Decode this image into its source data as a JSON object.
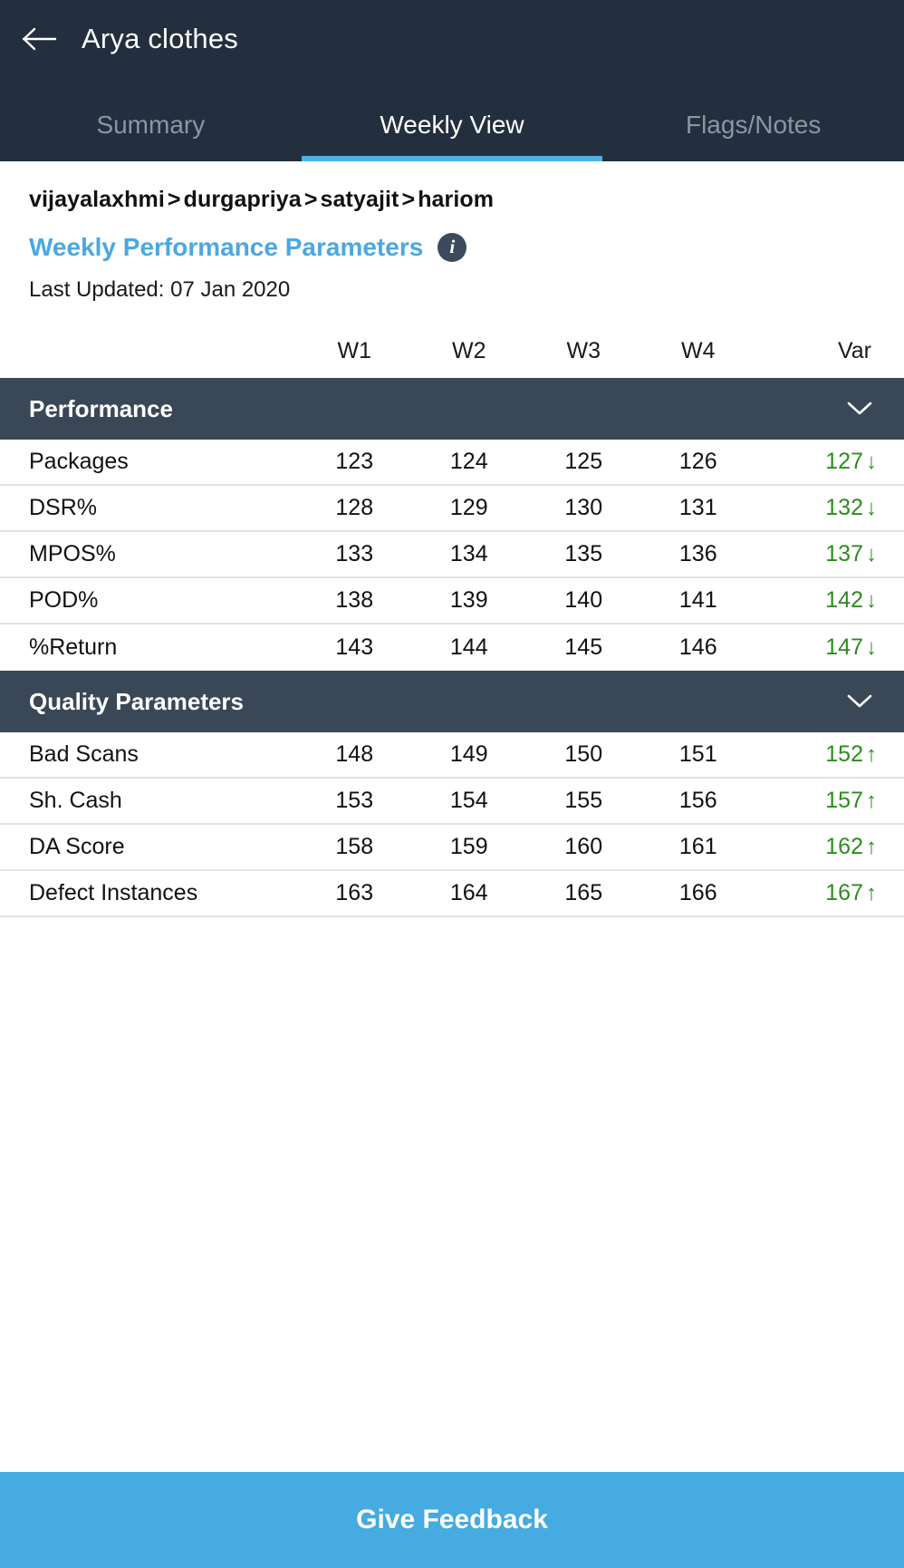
{
  "appbar": {
    "back_icon": "arrow-left-icon",
    "title": "Arya clothes",
    "tabs": [
      {
        "label": "Summary",
        "active": false
      },
      {
        "label": "Weekly View",
        "active": true
      },
      {
        "label": "Flags/Notes",
        "active": false
      }
    ],
    "background_color": "#232F3E",
    "active_tab_underline_color": "#4CB0E4"
  },
  "meta": {
    "breadcrumb": [
      "vijayalaxhmi",
      "durgapriya",
      "satyajit",
      "hariom"
    ],
    "breadcrumb_separator": ">",
    "section_title": "Weekly Performance Parameters",
    "section_title_color": "#4BA8E0",
    "info_icon": "info-icon",
    "info_icon_glyph": "i",
    "last_updated": "Last Updated: 07 Jan 2020"
  },
  "table": {
    "columns": [
      "W1",
      "W2",
      "W3",
      "W4",
      "Var"
    ],
    "groups": [
      {
        "title": "Performance",
        "chevron_icon": "chevron-down-icon",
        "rows": [
          {
            "label": "Packages",
            "values": [
              "123",
              "124",
              "125",
              "126"
            ],
            "var": "127",
            "trend": "down",
            "var_color": "#2E8B20"
          },
          {
            "label": "DSR%",
            "values": [
              "128",
              "129",
              "130",
              "131"
            ],
            "var": "132",
            "trend": "down",
            "var_color": "#2E8B20"
          },
          {
            "label": "MPOS%",
            "values": [
              "133",
              "134",
              "135",
              "136"
            ],
            "var": "137",
            "trend": "down",
            "var_color": "#2E8B20"
          },
          {
            "label": "POD%",
            "values": [
              "138",
              "139",
              "140",
              "141"
            ],
            "var": "142",
            "trend": "down",
            "var_color": "#2E8B20"
          },
          {
            "label": "%Return",
            "values": [
              "143",
              "144",
              "145",
              "146"
            ],
            "var": "147",
            "trend": "down",
            "var_color": "#2E8B20"
          }
        ]
      },
      {
        "title": "Quality Parameters",
        "chevron_icon": "chevron-down-icon",
        "rows": [
          {
            "label": "Bad Scans",
            "values": [
              "148",
              "149",
              "150",
              "151"
            ],
            "var": "152",
            "trend": "up",
            "var_color": "#2E8B20"
          },
          {
            "label": "Sh. Cash",
            "values": [
              "153",
              "154",
              "155",
              "156"
            ],
            "var": "157",
            "trend": "up",
            "var_color": "#2E8B20"
          },
          {
            "label": "DA Score",
            "values": [
              "158",
              "159",
              "160",
              "161"
            ],
            "var": "162",
            "trend": "up",
            "var_color": "#2E8B20"
          },
          {
            "label": "Defect Instances",
            "values": [
              "163",
              "164",
              "165",
              "166"
            ],
            "var": "167",
            "trend": "up",
            "var_color": "#2E8B20"
          }
        ]
      }
    ]
  },
  "footer": {
    "label": "Give Feedback",
    "background_color": "#45ABE0"
  },
  "arrows": {
    "up": "↑",
    "down": "↓"
  }
}
